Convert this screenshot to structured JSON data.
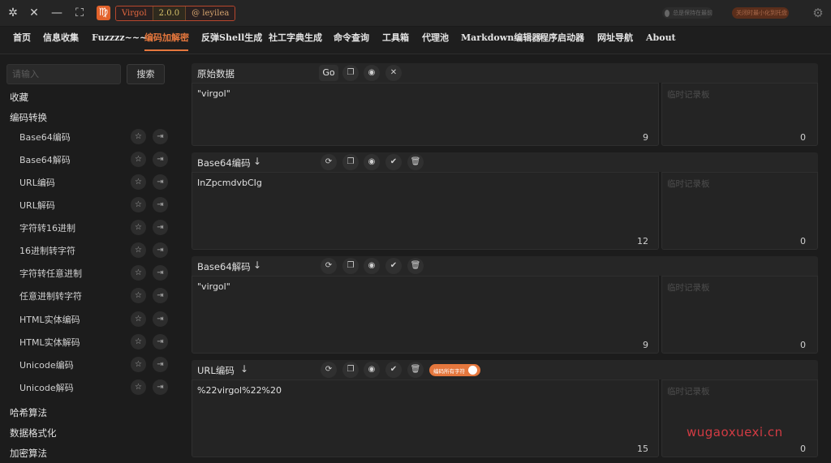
{
  "titlebar": {
    "icons": [
      "pin-icon",
      "close-icon",
      "minimize-icon",
      "maximize-icon"
    ],
    "logo_glyph": "♍",
    "app_name": "Virgol",
    "version": "2.0.0",
    "author": "@ leyilea",
    "toggle1_label": "总是保持在最前",
    "toggle2_label": "关闭时最小化到托盘"
  },
  "nav": {
    "items": [
      "首页",
      "信息收集",
      "Fuzzzz~~~",
      "编码加解密",
      "反弹Shell生成",
      "社工字典生成",
      "命令查询",
      "工具箱",
      "代理池",
      "Markdown编辑器",
      "程序启动器",
      "网址导航",
      "About"
    ],
    "active_index": 3,
    "accent": "#e5773d"
  },
  "sidebar": {
    "search_placeholder": "请输入",
    "search_button": "搜索",
    "favorites": "收藏",
    "group_encoding": "编码转换",
    "items": [
      "Base64编码",
      "Base64解码",
      "URL编码",
      "URL解码",
      "字符转16进制",
      "16进制转字符",
      "字符转任意进制",
      "任意进制转字符",
      "HTML实体编码",
      "HTML实体解码",
      "Unicode编码",
      "Unicode解码"
    ],
    "group_hash": "哈希算法",
    "group_format": "数据格式化",
    "group_crypto": "加密算法"
  },
  "panels": [
    {
      "title": "原始数据",
      "go_label": "Go",
      "content": "\"virgol\"",
      "count": "9",
      "notepad_placeholder": "临时记录板",
      "notepad_count": "0"
    },
    {
      "title": "Base64编码",
      "content": "InZpcmdvbCIg",
      "count": "12",
      "notepad_placeholder": "临时记录板",
      "notepad_count": "0"
    },
    {
      "title": "Base64解码",
      "content": "\"virgol\"",
      "count": "9",
      "notepad_placeholder": "临时记录板",
      "notepad_count": "0"
    },
    {
      "title": "URL编码",
      "toggle_label": "编码所有字符",
      "content": "%22virgol%22%20",
      "count": "15",
      "notepad_placeholder": "临时记录板",
      "notepad_count": "0"
    }
  ],
  "watermark": "wugaoxuexi.cn"
}
